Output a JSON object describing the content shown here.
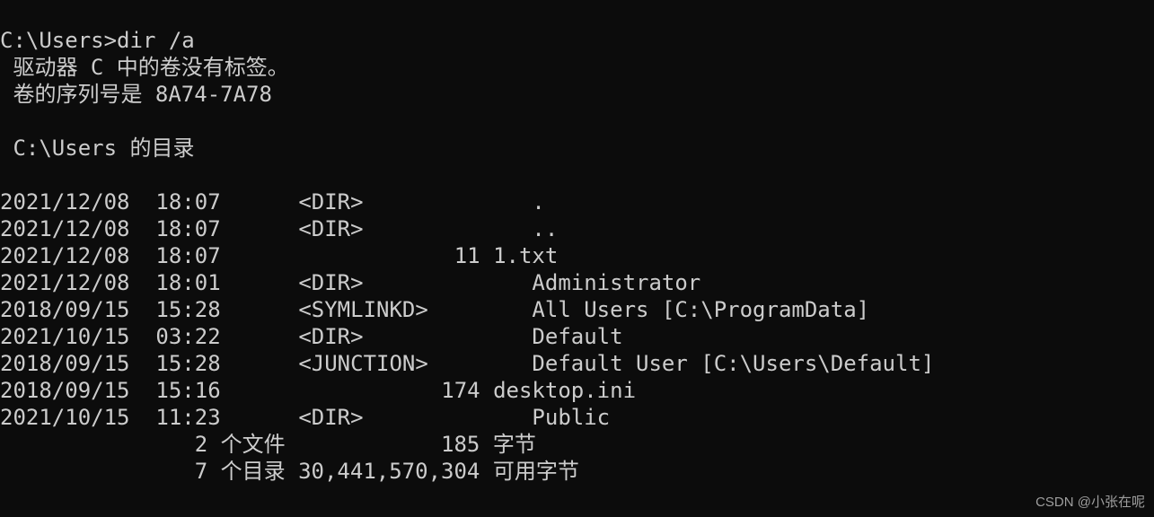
{
  "prompt": "C:\\Users>",
  "command": "dir /a",
  "volume_line": " 驱动器 C 中的卷没有标签。",
  "serial_line": " 卷的序列号是 8A74-7A78",
  "blank1": "",
  "dir_of_line": " C:\\Users 的目录",
  "blank2": "",
  "entries": [
    {
      "date": "2021/12/08",
      "time": "18:07",
      "type": "<DIR>",
      "size": "",
      "name": "."
    },
    {
      "date": "2021/12/08",
      "time": "18:07",
      "type": "<DIR>",
      "size": "",
      "name": ".."
    },
    {
      "date": "2021/12/08",
      "time": "18:07",
      "type": "",
      "size": "11",
      "name": "1.txt"
    },
    {
      "date": "2021/12/08",
      "time": "18:01",
      "type": "<DIR>",
      "size": "",
      "name": "Administrator"
    },
    {
      "date": "2018/09/15",
      "time": "15:28",
      "type": "<SYMLINKD>",
      "size": "",
      "name": "All Users [C:\\ProgramData]"
    },
    {
      "date": "2021/10/15",
      "time": "03:22",
      "type": "<DIR>",
      "size": "",
      "name": "Default"
    },
    {
      "date": "2018/09/15",
      "time": "15:28",
      "type": "<JUNCTION>",
      "size": "",
      "name": "Default User [C:\\Users\\Default]"
    },
    {
      "date": "2018/09/15",
      "time": "15:16",
      "type": "",
      "size": "174",
      "name": "desktop.ini"
    },
    {
      "date": "2021/10/15",
      "time": "11:23",
      "type": "<DIR>",
      "size": "",
      "name": "Public"
    }
  ],
  "summary": {
    "file_count": "2",
    "file_label": "个文件",
    "file_bytes": "185",
    "file_bytes_label": "字节",
    "dir_count": "7",
    "dir_label": "个目录",
    "free_bytes": "30,441,570,304",
    "free_label": "可用字节"
  },
  "watermark": "CSDN @小张在呢"
}
